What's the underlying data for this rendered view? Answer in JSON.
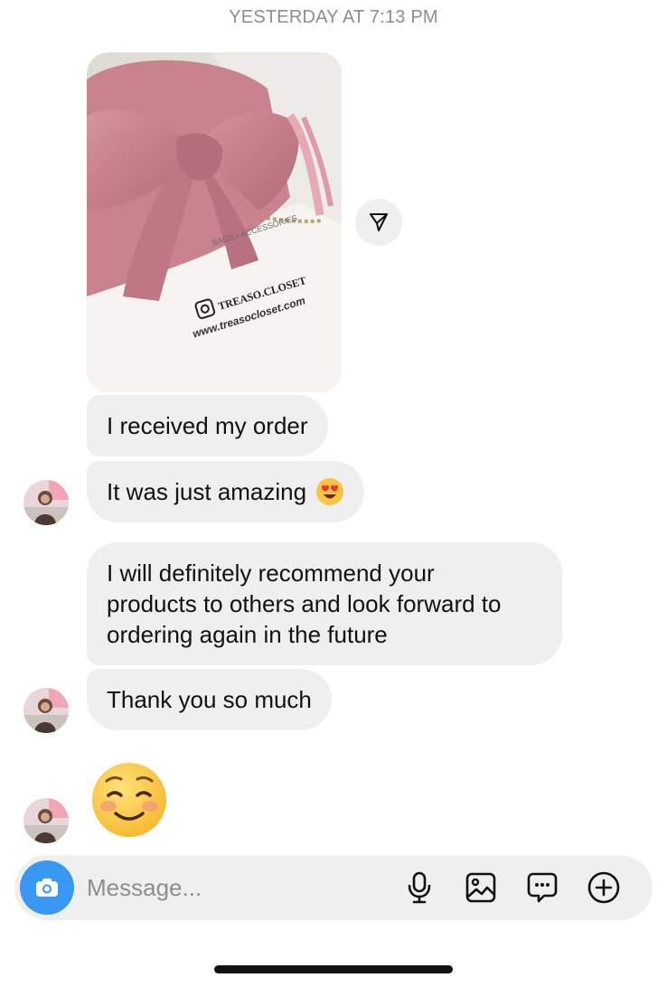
{
  "header": {
    "timestamp": "YESTERDAY AT 7:13 PM"
  },
  "shared_photo": {
    "brand_text": "TREASO.CLOSET",
    "url_text": "www.treasocloset.com",
    "ribbon_text": "BAGS • ACCESSORIES",
    "colors": {
      "bow": "#c98490",
      "bag": "#f3f1ee"
    }
  },
  "messages": [
    {
      "text": "I received my order"
    },
    {
      "text": "It was just amazing",
      "emoji": "heart-eyes-emoji"
    },
    {
      "lines": [
        "I will definitely recommend your",
        "products to others and look forward to",
        "ordering again in the future"
      ]
    },
    {
      "text": "Thank you so much"
    },
    {
      "emoji": "smiling-blush-emoji"
    }
  ],
  "composer": {
    "placeholder": "Message...",
    "icons": [
      "camera-icon",
      "microphone-icon",
      "gallery-icon",
      "sticker-icon",
      "plus-icon"
    ],
    "accent_color": "#3897f0"
  }
}
